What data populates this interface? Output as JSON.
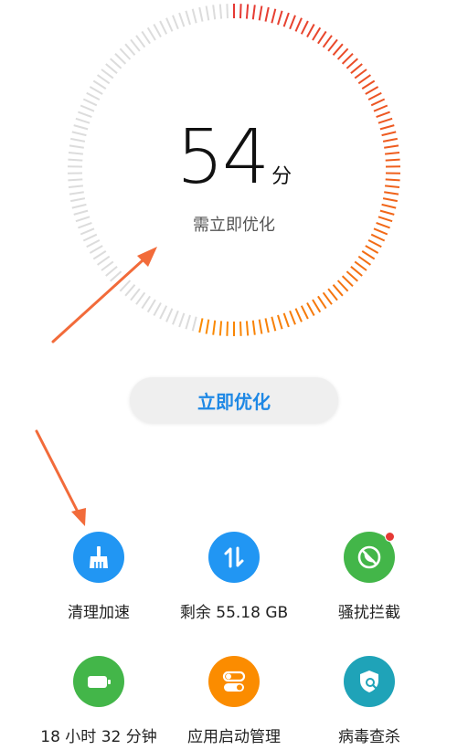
{
  "score": {
    "value": "54",
    "unit": "分",
    "status": "需立即优化",
    "fraction": 0.54
  },
  "optimize_button": {
    "label": "立即优化"
  },
  "tools": [
    {
      "label": "清理加速",
      "icon": "broom-icon",
      "color": "#2196f3"
    },
    {
      "label": "剩余 55.18 GB",
      "icon": "storage-arrows-icon",
      "color": "#2196f3"
    },
    {
      "label": "骚扰拦截",
      "icon": "blocked-call-icon",
      "color": "#43b649",
      "badge": true
    },
    {
      "label": "18 小时 32 分钟",
      "icon": "battery-icon",
      "color": "#43b649"
    },
    {
      "label": "应用启动管理",
      "icon": "toggle-icon",
      "color": "#fb8c00"
    },
    {
      "label": "病毒查杀",
      "icon": "shield-search-icon",
      "color": "#1fa3b8"
    }
  ],
  "colors": {
    "accent": "#1e88e5",
    "gauge_red": "#e53935",
    "gauge_orange": "#fb8c00",
    "gauge_inactive": "#dcdcdc",
    "annotation_arrow": "#f26b3a"
  }
}
